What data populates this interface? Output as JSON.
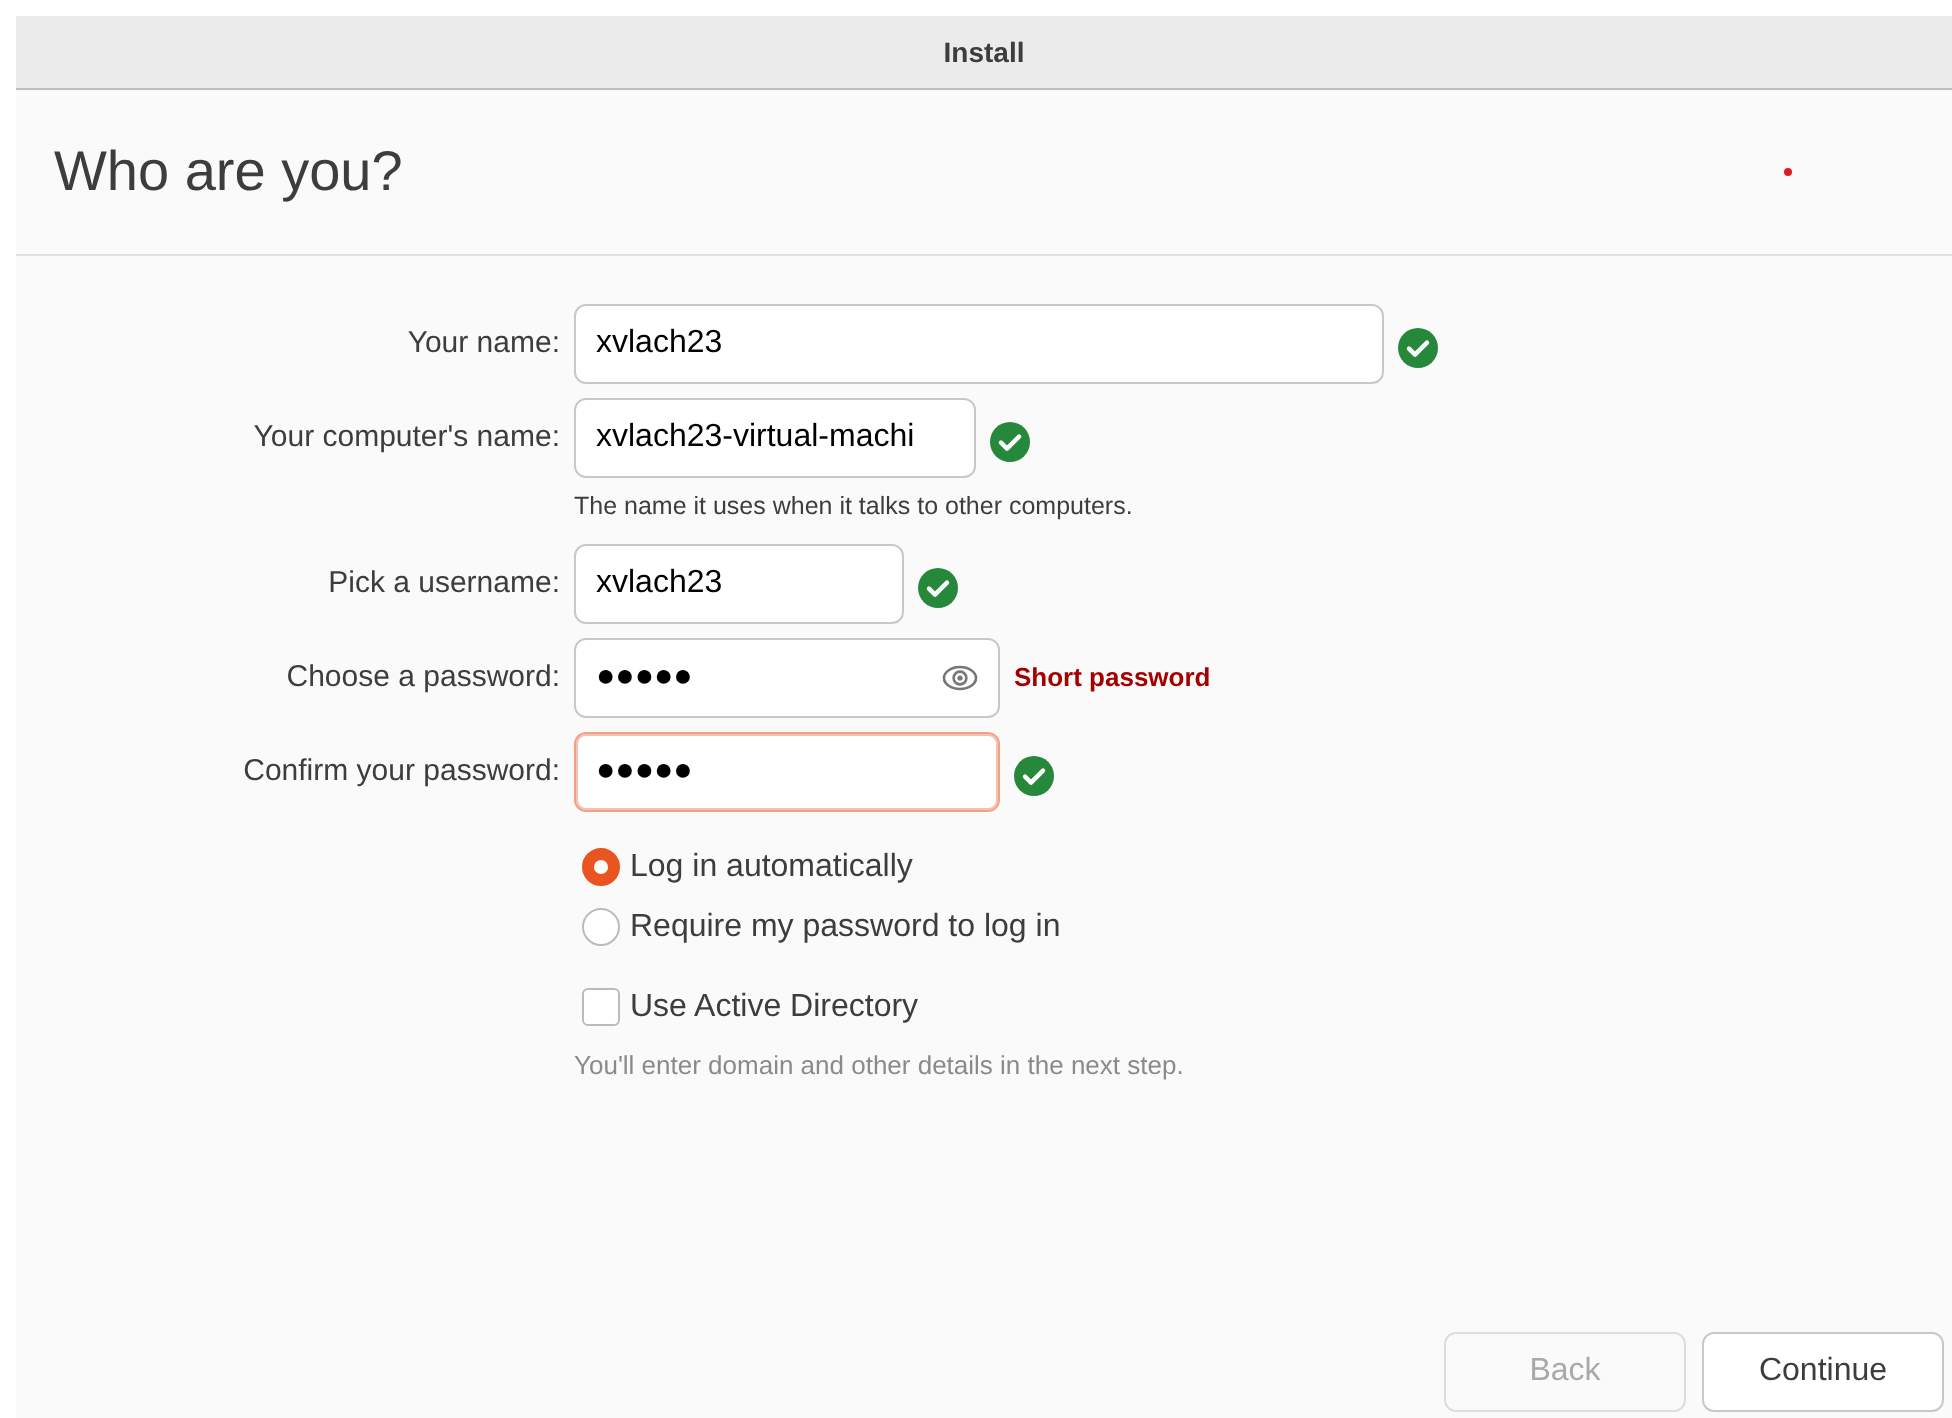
{
  "window": {
    "title": "Install"
  },
  "header": {
    "title": "Who are you?"
  },
  "fields": [
    {
      "label": "Your name:",
      "value": "xvlach23",
      "valid": true,
      "focused": false,
      "reveal_button": false
    },
    {
      "label": "Your computer's name:",
      "value": "xvlach23-virtual-machi",
      "valid": true,
      "focused": false,
      "reveal_button": false,
      "hint": "The name it uses when it talks to other computers."
    },
    {
      "label": "Pick a username:",
      "value": "xvlach23",
      "valid": true,
      "focused": false,
      "reveal_button": false
    },
    {
      "label": "Choose a password:",
      "value": "●●●●●",
      "valid": false,
      "warning": "Short password",
      "focused": false,
      "reveal_button": true
    },
    {
      "label": "Confirm your password:",
      "value": "●●●●●",
      "valid": true,
      "focused": true,
      "reveal_button": false
    }
  ],
  "login_options": [
    {
      "label": "Log in automatically",
      "selected": true
    },
    {
      "label": "Require my password to log in",
      "selected": false
    }
  ],
  "active_directory": {
    "label": "Use Active Directory",
    "checked": false,
    "hint": "You'll enter domain and other details in the next step."
  },
  "buttons": [
    {
      "label": "Back",
      "disabled": true
    },
    {
      "label": "Continue",
      "disabled": false
    }
  ]
}
